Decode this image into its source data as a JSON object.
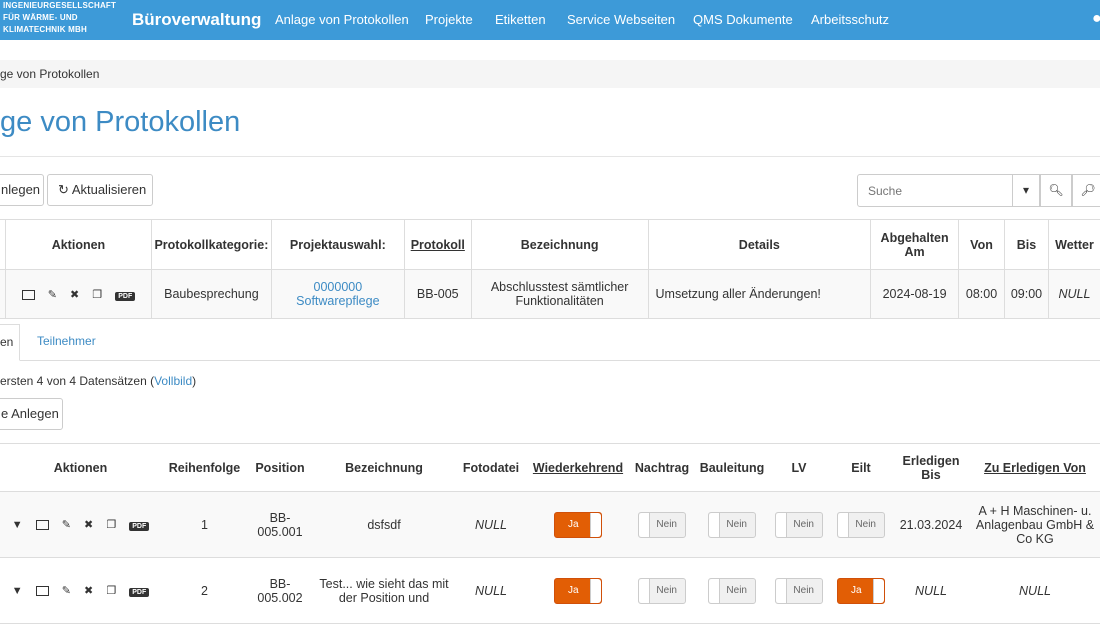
{
  "navbar": {
    "brand_small": [
      "INGENIEURGESELLSCHAFT",
      "FÜR WÄRME- UND",
      "KLIMATECHNIK MBH"
    ],
    "brand": "Büroverwaltung",
    "items": [
      "Anlage von Protokollen",
      "Projekte",
      "Etiketten",
      "Service Webseiten",
      "QMS Dokumente",
      "Arbeitsschutz"
    ]
  },
  "breadcrumb": "ge von Protokollen",
  "title": "ge von Protokollen",
  "toolbar": {
    "anlegen": "nlegen",
    "aktualisieren": "Aktualisieren"
  },
  "search": {
    "placeholder": "Suche"
  },
  "table1": {
    "headers": [
      "Aktionen",
      "Protokollkategorie:",
      "Projektauswahl:",
      "Protokoll",
      "Bezeichnung",
      "Details",
      "Abgehalten Am",
      "Von",
      "Bis",
      "Wetter"
    ],
    "row": {
      "kategorie": "Baubesprechung",
      "projekt": "0000000 Softwarepflege",
      "protokoll": "BB-005",
      "bezeichnung": "Abschlusstest sämtlicher Funktionalitäten",
      "details": "Umsetzung aller Änderungen!",
      "am": "2024-08-19",
      "von": "08:00",
      "bis": "09:00",
      "wetter": "NULL"
    }
  },
  "tabs": {
    "active": "en",
    "other": "Teilnehmer"
  },
  "info": {
    "prefix": "ersten 4 von 4 Datensätzen (",
    "link": "Vollbild",
    "suffix": ")"
  },
  "anlegen2": "e Anlegen",
  "table2": {
    "headers": [
      "Aktionen",
      "Reihenfolge",
      "Position",
      "Bezeichnung",
      "Fotodatei",
      "Wiederkehrend",
      "Nachtrag",
      "Bauleitung",
      "LV",
      "Eilt",
      "Erledigen Bis",
      "Zu Erledigen Von"
    ],
    "rows": [
      {
        "reihenfolge": "1",
        "position": "BB-005.001",
        "bezeichnung": "dsfsdf",
        "foto": "NULL",
        "wiederkehrend": "Ja",
        "nachtrag": "Nein",
        "bauleitung": "Nein",
        "lv": "Nein",
        "eilt": "Nein",
        "bis": "21.03.2024",
        "von": "A + H Maschinen- u. Anlagenbau GmbH & Co KG"
      },
      {
        "reihenfolge": "2",
        "position": "BB-005.002",
        "bezeichnung": "Test... wie sieht das mit der Position und",
        "foto": "NULL",
        "wiederkehrend": "Ja",
        "nachtrag": "Nein",
        "bauleitung": "Nein",
        "lv": "Nein",
        "eilt": "Ja",
        "bis": "NULL",
        "von": "NULL"
      }
    ]
  },
  "colors": {
    "nav": "#3d9ad8",
    "accent": "#3d8bc4",
    "toggle_on": "#e25e05"
  }
}
